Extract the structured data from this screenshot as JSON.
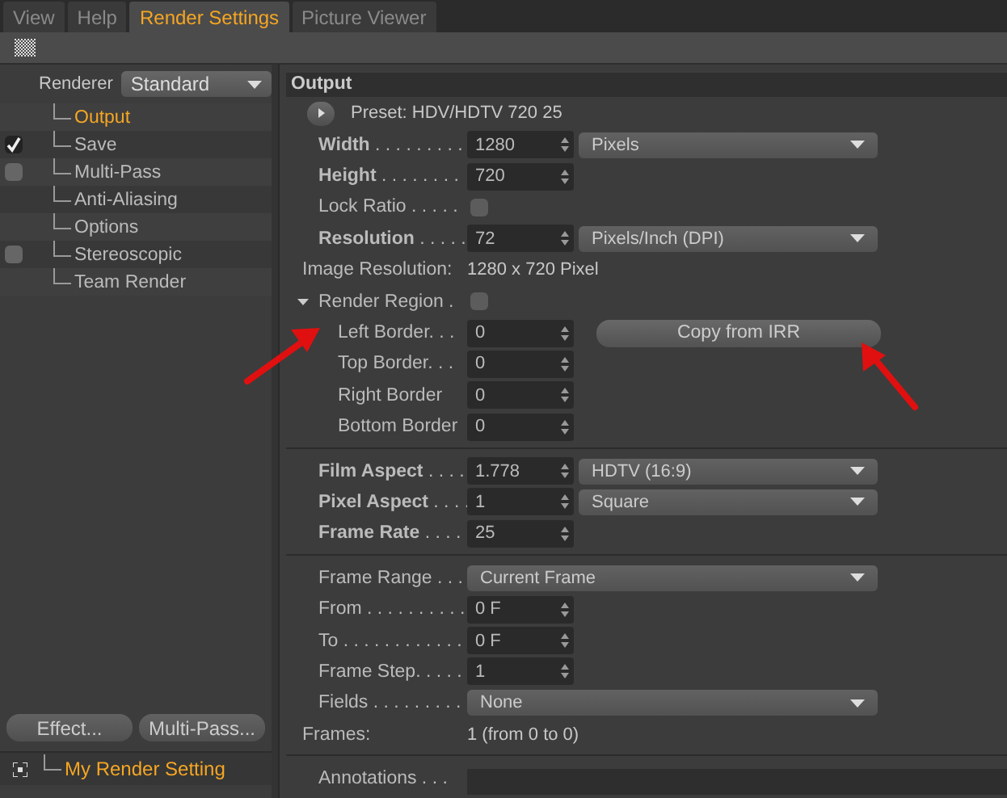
{
  "tabs": [
    {
      "label": "View",
      "selected": false
    },
    {
      "label": "Help",
      "selected": false
    },
    {
      "label": "Render Settings",
      "selected": true
    },
    {
      "label": "Picture Viewer",
      "selected": false
    }
  ],
  "sidebar": {
    "renderer_label": "Renderer",
    "renderer_value": "Standard",
    "items": [
      {
        "label": "Output",
        "selected": true
      },
      {
        "label": "Save",
        "selected": false,
        "checked": true
      },
      {
        "label": "Multi-Pass",
        "selected": false,
        "checked": false
      },
      {
        "label": "Anti-Aliasing",
        "selected": false
      },
      {
        "label": "Options",
        "selected": false
      },
      {
        "label": "Stereoscopic",
        "selected": false,
        "checked": false
      },
      {
        "label": "Team Render",
        "selected": false
      }
    ],
    "buttons": [
      "Effect...",
      "Multi-Pass..."
    ],
    "settings": [
      {
        "label": "My Render Setting",
        "selected": true
      }
    ]
  },
  "output": {
    "title": "Output",
    "preset": "Preset: HDV/HDTV 720 25",
    "groups": [
      [
        {
          "kind": "number",
          "label": "**Width** . . . . . . . . .",
          "value": "1280",
          "dropdown": "Pixels"
        },
        {
          "kind": "number",
          "label": "**Height** . . . . . . . .",
          "value": "720"
        },
        {
          "kind": "checkbox",
          "label": "Lock Ratio . . . . .",
          "checked": false
        },
        {
          "kind": "number",
          "label": "**Resolution** . . . . .",
          "value": "72",
          "dropdown": "Pixels/Inch (DPI)"
        },
        {
          "kind": "info",
          "label": "Image Resolution:",
          "value": "1280 x 720 Pixel"
        },
        {
          "kind": "checkbox",
          "label": "Render Region .",
          "checked": false,
          "expanded": true,
          "children": [
            {
              "kind": "number",
              "label": "Left Border. . .",
              "value": "0",
              "button": "Copy from IRR"
            },
            {
              "kind": "number",
              "label": "Top Border. . .",
              "value": "0"
            },
            {
              "kind": "number",
              "label": "Right Border",
              "value": "0"
            },
            {
              "kind": "number",
              "label": "Bottom Border",
              "value": "0"
            }
          ]
        }
      ],
      [
        {
          "kind": "number",
          "label": "**Film Aspect** . . . .",
          "value": "1.778",
          "dropdown": "HDTV (16:9)"
        },
        {
          "kind": "number",
          "label": "**Pixel Aspect** . . . .",
          "value": "1",
          "dropdown": "Square"
        },
        {
          "kind": "number",
          "label": "**Frame Rate** . . . .",
          "value": "25"
        }
      ],
      [
        {
          "kind": "dropdown",
          "label": "Frame Range . . .",
          "value": "Current Frame"
        },
        {
          "kind": "number",
          "label": "From . . . . . . . . . .",
          "value": "0 F"
        },
        {
          "kind": "number",
          "label": "To . . . . . . . . . . . .",
          "value": "0 F"
        },
        {
          "kind": "number",
          "label": "Frame Step. . . . .",
          "value": "1"
        },
        {
          "kind": "dropdown",
          "label": "Fields . . . . . . . . .",
          "value": "None"
        },
        {
          "kind": "info",
          "label": "Frames:",
          "value": "1 (from 0 to 0)"
        }
      ],
      [
        {
          "kind": "textarea",
          "label": "Annotations . . ."
        }
      ]
    ]
  }
}
